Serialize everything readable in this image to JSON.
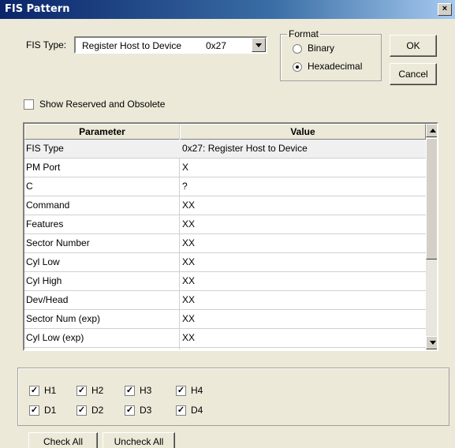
{
  "window": {
    "title": "FIS Pattern",
    "close_label": "×"
  },
  "fis_type": {
    "label": "FIS Type:",
    "name": "Register Host to Device",
    "code": "0x27"
  },
  "format": {
    "title": "Format",
    "options": [
      {
        "label": "Binary",
        "selected": false
      },
      {
        "label": "Hexadecimal",
        "selected": true
      }
    ]
  },
  "buttons": {
    "ok": "OK",
    "cancel": "Cancel",
    "check_all": "Check All",
    "uncheck_all": "Uncheck All"
  },
  "show_reserved": {
    "label": "Show Reserved and Obsolete",
    "checked": false
  },
  "table": {
    "headers": [
      "Parameter",
      "Value"
    ],
    "rows": [
      {
        "parameter": "FIS Type",
        "value": "0x27: Register Host to Device"
      },
      {
        "parameter": "PM Port",
        "value": "X"
      },
      {
        "parameter": "C",
        "value": "?"
      },
      {
        "parameter": "Command",
        "value": "XX"
      },
      {
        "parameter": "Features",
        "value": "XX"
      },
      {
        "parameter": "Sector Number",
        "value": "XX"
      },
      {
        "parameter": "Cyl Low",
        "value": "XX"
      },
      {
        "parameter": "Cyl High",
        "value": "XX"
      },
      {
        "parameter": "Dev/Head",
        "value": "XX"
      },
      {
        "parameter": "Sector Num (exp)",
        "value": "XX"
      },
      {
        "parameter": "Cyl Low (exp)",
        "value": "XX"
      }
    ]
  },
  "checks": [
    {
      "label": "H1",
      "checked": true
    },
    {
      "label": "H2",
      "checked": true
    },
    {
      "label": "H3",
      "checked": true
    },
    {
      "label": "H4",
      "checked": true
    },
    {
      "label": "D1",
      "checked": true
    },
    {
      "label": "D2",
      "checked": true
    },
    {
      "label": "D3",
      "checked": true
    },
    {
      "label": "D4",
      "checked": true
    }
  ]
}
